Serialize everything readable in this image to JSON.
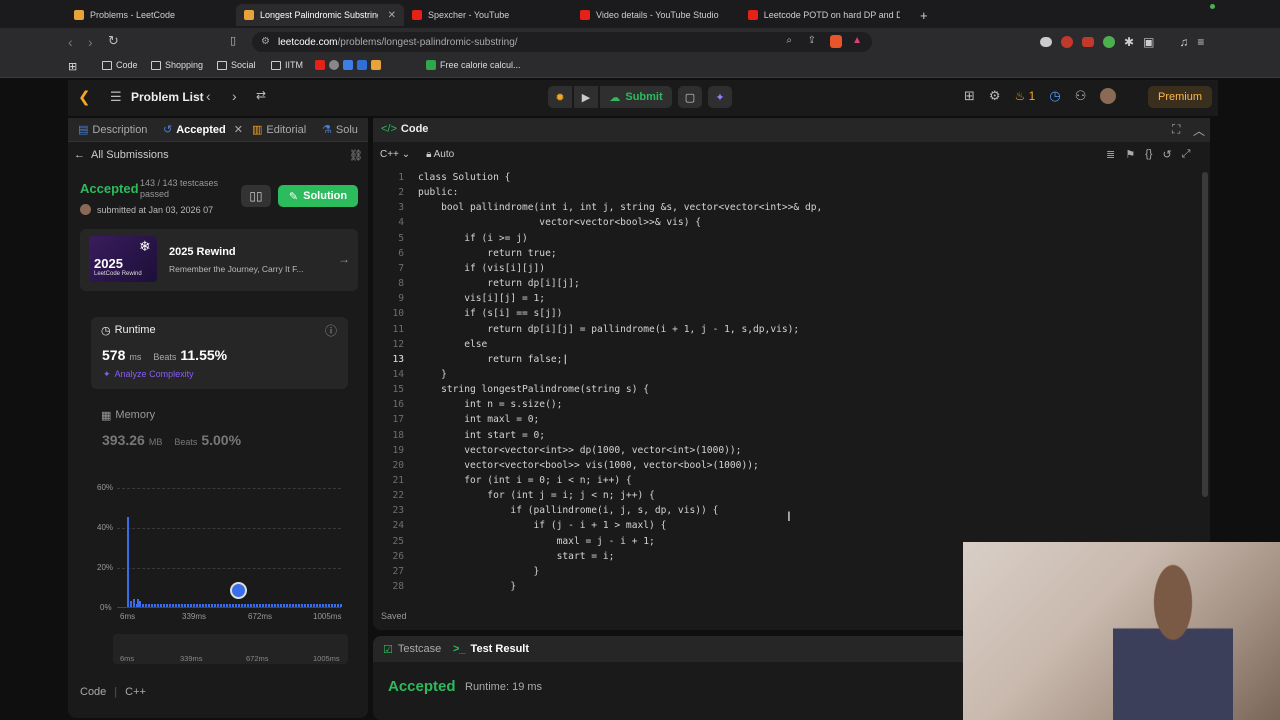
{
  "browser": {
    "tabs": [
      {
        "title": "Problems - LeetCode",
        "color": "#e8a43a"
      },
      {
        "title": "Longest Palindromic Substring",
        "color": "#e8a43a"
      },
      {
        "title": "Spexcher - YouTube",
        "color": "#e62117"
      },
      {
        "title": "Video details - YouTube Studio",
        "color": "#e62117"
      },
      {
        "title": "Leetcode POTD on hard DP and D",
        "color": "#e62117"
      }
    ],
    "new_tab": "+",
    "url_host": "leetcode.com",
    "url_path": "/problems/longest-palindromic-substring/",
    "bookmarks": [
      "Code",
      "Shopping",
      "Social",
      "IITM",
      "Free calorie calcul..."
    ]
  },
  "app": {
    "problem_list": "Problem List",
    "submit": "Submit",
    "streak": "1",
    "premium": "Premium"
  },
  "left": {
    "tabs": [
      "Description",
      "Accepted",
      "Editorial",
      "Solu"
    ],
    "all_submissions": "All Submissions",
    "status": "Accepted",
    "testcases": "143 / 143 testcases",
    "passed": "passed",
    "submitted": "submitted at Jan 03, 2026 07",
    "solution_btn": "Solution",
    "rewind_year": "2025",
    "rewind_sub": "LeetCode Rewind",
    "rewind_title": "2025 Rewind",
    "rewind_desc": "Remember the Journey, Carry It F...",
    "runtime_label": "Runtime",
    "runtime_value": "578",
    "runtime_unit": "ms",
    "beats": "Beats",
    "runtime_beats": "11.55%",
    "analyze": "Analyze Complexity",
    "memory_label": "Memory",
    "memory_value": "393.26",
    "memory_unit": "MB",
    "memory_beats": "5.00%",
    "lang_label": "Code",
    "lang": "C++"
  },
  "chart_data": {
    "type": "bar",
    "y_ticks": [
      "60%",
      "40%",
      "20%",
      "0%"
    ],
    "x_ticks": [
      "6ms",
      "339ms",
      "672ms",
      "1005ms"
    ],
    "ylim": [
      0,
      60
    ],
    "bars": [
      {
        "x_frac": 0.0,
        "value": 45
      },
      {
        "x_frac": 0.012,
        "value": 3
      },
      {
        "x_frac": 0.03,
        "value": 4
      },
      {
        "x_frac": 0.045,
        "value": 4
      },
      {
        "x_frac": 0.055,
        "value": 3
      }
    ],
    "baseline_value": 1.5
  },
  "editor": {
    "title": "Code",
    "lang": "C++",
    "mode": "Auto",
    "saved": "Saved",
    "lines": [
      "class Solution {",
      "public:",
      "    bool pallindrome(int i, int j, string &s, vector<vector<int>>& dp,",
      "                     vector<vector<bool>>& vis) {",
      "        if (i >= j)",
      "            return true;",
      "        if (vis[i][j])",
      "            return dp[i][j];",
      "        vis[i][j] = 1;",
      "        if (s[i] == s[j])",
      "            return dp[i][j] = pallindrome(i + 1, j - 1, s,dp,vis);",
      "        else",
      "            return false;",
      "    }",
      "    string longestPalindrome(string s) {",
      "        int n = s.size();",
      "        int maxl = 0;",
      "        int start = 0;",
      "        vector<vector<int>> dp(1000, vector<int>(1000));",
      "        vector<vector<bool>> vis(1000, vector<bool>(1000));",
      "        for (int i = 0; i < n; i++) {",
      "            for (int j = i; j < n; j++) {",
      "                if (pallindrome(i, j, s, dp, vis)) {",
      "                    if (j - i + 1 > maxl) {",
      "                        maxl = j - i + 1;",
      "                        start = i;",
      "                    }",
      "                }"
    ],
    "current_line": 13
  },
  "result": {
    "tab_testcase": "Testcase",
    "tab_result": "Test Result",
    "status": "Accepted",
    "runtime": "Runtime: 19 ms"
  }
}
